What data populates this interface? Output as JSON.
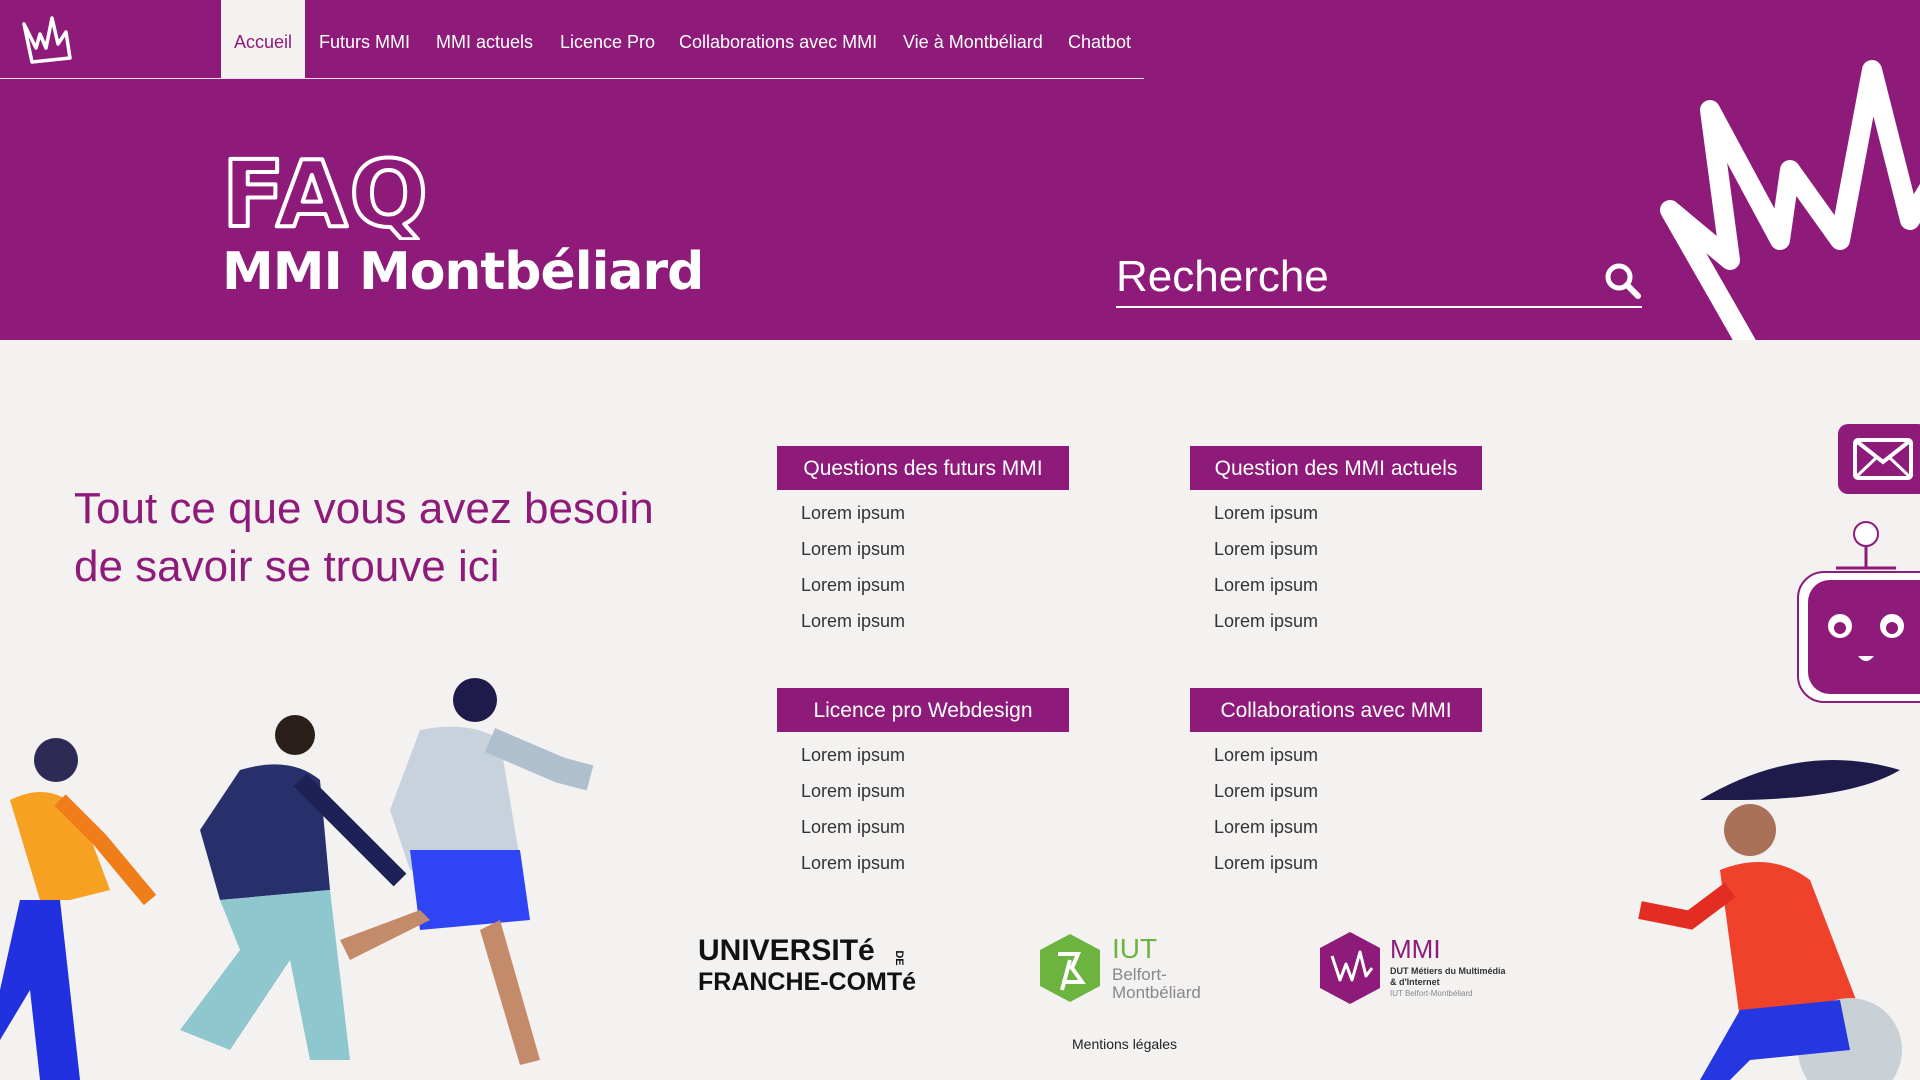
{
  "nav": {
    "items": [
      {
        "label": "Accueil",
        "active": true
      },
      {
        "label": "Futurs MMI"
      },
      {
        "label": "MMI actuels"
      },
      {
        "label": "Licence Pro"
      },
      {
        "label": "Collaborations avec MMI"
      },
      {
        "label": "Vie à Montbéliard"
      },
      {
        "label": "Chatbot"
      }
    ]
  },
  "hero": {
    "faq": "FAQ",
    "subtitle": "MMI Montbéliard",
    "search_placeholder": "Recherche"
  },
  "main": {
    "tagline": "Tout ce que vous avez besoin de savoir se trouve ici",
    "categories": [
      {
        "title": "Questions des futurs MMI",
        "items": [
          "Lorem ipsum",
          "Lorem ipsum",
          "Lorem ipsum",
          "Lorem ipsum"
        ]
      },
      {
        "title": "Question des MMI actuels",
        "items": [
          "Lorem ipsum",
          "Lorem ipsum",
          "Lorem ipsum",
          "Lorem ipsum"
        ]
      },
      {
        "title": "Licence pro Webdesign",
        "items": [
          "Lorem ipsum",
          "Lorem ipsum",
          "Lorem ipsum",
          "Lorem ipsum"
        ]
      },
      {
        "title": "Collaborations avec MMI",
        "items": [
          "Lorem ipsum",
          "Lorem ipsum",
          "Lorem ipsum",
          "Lorem ipsum"
        ]
      }
    ]
  },
  "footer": {
    "ufc": {
      "line1": "UNIVERSITé",
      "de": "DE",
      "line2": "FRANCHE-COMTé"
    },
    "iut": {
      "title": "IUT",
      "line1": "Belfort-",
      "line2": "Montbéliard"
    },
    "mmi": {
      "title": "MMI",
      "line1": "DUT Métiers du Multimédia",
      "line2": "& d'Internet",
      "line3": "IUT Belfort-Montbéliard"
    },
    "legal": "Mentions légales"
  },
  "colors": {
    "brand": "#8e1b7a",
    "background": "#f4f2f1",
    "iut_green": "#6db33f"
  },
  "icons": [
    "crown-logo-icon",
    "search-icon",
    "mail-icon",
    "chatbot-icon"
  ]
}
